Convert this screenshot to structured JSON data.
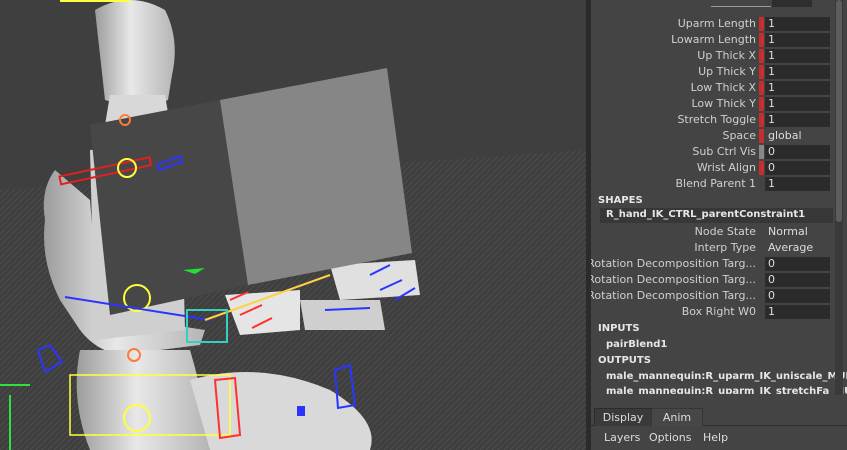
{
  "channel_box": {
    "attributes": [
      {
        "label": "Uparm Length",
        "value": "1",
        "marker": "red"
      },
      {
        "label": "Lowarm Length",
        "value": "1",
        "marker": "red"
      },
      {
        "label": "Up Thick X",
        "value": "1",
        "marker": "red"
      },
      {
        "label": "Up Thick Y",
        "value": "1",
        "marker": "red"
      },
      {
        "label": "Low Thick X",
        "value": "1",
        "marker": "red"
      },
      {
        "label": "Low Thick Y",
        "value": "1",
        "marker": "red"
      },
      {
        "label": "Stretch Toggle",
        "value": "1",
        "marker": "red"
      },
      {
        "label": "Space",
        "value": "global",
        "marker": "red"
      },
      {
        "label": "Sub Ctrl Vis",
        "value": "0",
        "marker": "grey"
      },
      {
        "label": "Wrist Align",
        "value": "0",
        "marker": "red"
      },
      {
        "label": "Blend Parent 1",
        "value": "1",
        "marker": "none"
      }
    ],
    "shapes_header": "SHAPES",
    "constraint_node": "R_hand_IK_CTRL_parentConstraint1",
    "constraint_attributes": [
      {
        "label": "Node State",
        "value": "Normal"
      },
      {
        "label": "Interp Type",
        "value": "Average"
      },
      {
        "label": "Rotation Decomposition Targ...",
        "value": "0"
      },
      {
        "label": "Rotation Decomposition Targ...",
        "value": "0"
      },
      {
        "label": "Rotation Decomposition Targ...",
        "value": "0"
      },
      {
        "label": "Box Right W0",
        "value": "1"
      }
    ],
    "inputs_header": "INPUTS",
    "inputs": [
      "pairBlend1"
    ],
    "outputs_header": "OUTPUTS",
    "outputs": [
      "male_mannequin:R_uparm_IK_uniscale_MULT",
      "male_mannequin:R_uparm_IK_stretchFa_MULT"
    ]
  },
  "bottom_panel": {
    "tabs": [
      "Display",
      "Anim"
    ],
    "menu": [
      "Layers",
      "Options",
      "Help"
    ]
  },
  "colors": {
    "viewport_bg": "#3f3f3f",
    "panel_bg": "#444444",
    "keyed_marker": "#c62f2f",
    "field_bg": "#2b2b2b"
  }
}
